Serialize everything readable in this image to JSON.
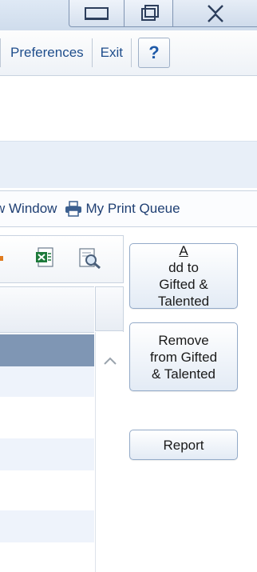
{
  "window_controls": {
    "minimize_icon": "minimize-icon",
    "maximize_icon": "restore-icon",
    "close_icon": "close-icon"
  },
  "menubar": {
    "preferences": "Preferences",
    "exit": "Exit",
    "help": "?"
  },
  "linkbar": {
    "new_window": "w Window",
    "print_queue": "My Print Queue"
  },
  "grid_toolbar": {
    "icons": [
      "excel-export-icon",
      "print-preview-icon"
    ]
  },
  "grid": {
    "rows": [
      {
        "style": "selected"
      },
      {
        "style": "alt"
      },
      {
        "style": "plain"
      },
      {
        "style": "alt"
      },
      {
        "style": "plain"
      },
      {
        "style": "alt"
      }
    ]
  },
  "actions": {
    "add_prefix": "A",
    "add_rest": "dd to",
    "add_line2": "Gifted &",
    "add_line3": "Talented",
    "remove_line1": "Remove",
    "remove_line2": "from Gifted",
    "remove_line3": "& Talented",
    "report": "Report"
  },
  "colors": {
    "selected_row": "#7f96b4",
    "alt_row": "#eef3fb",
    "link_text": "#1f4e8c"
  }
}
